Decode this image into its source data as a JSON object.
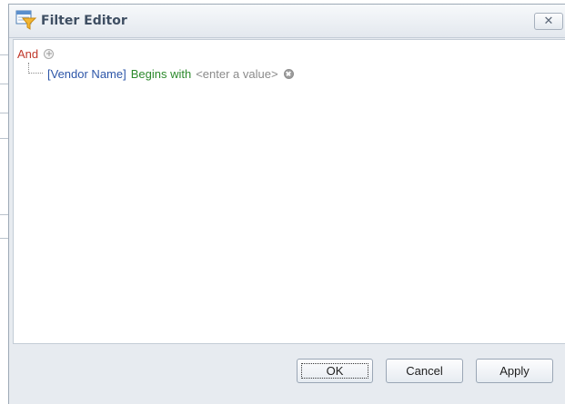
{
  "window": {
    "title": "Filter Editor",
    "close_glyph": "✕"
  },
  "filter": {
    "root_operator": "And",
    "conditions": [
      {
        "field": "[Vendor Name]",
        "operation": "Begins with",
        "value_placeholder": "<enter a value>"
      }
    ]
  },
  "buttons": {
    "ok": "OK",
    "cancel": "Cancel",
    "apply": "Apply"
  },
  "icons": {
    "title": "filter-editor-icon",
    "add_condition": "plus-circle-icon",
    "remove_condition": "remove-circle-icon"
  },
  "colors": {
    "operator": "#c0392b",
    "field": "#2d56a8",
    "operation": "#2c8a2c",
    "value": "#8b8b8b"
  }
}
